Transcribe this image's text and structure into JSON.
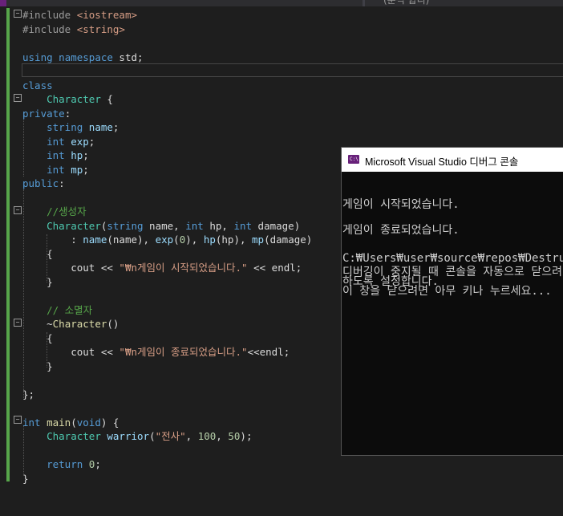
{
  "window": {
    "tab_text": "(분석 합니)"
  },
  "editor": {
    "lines": [
      {
        "parts": [
          {
            "t": "#include ",
            "c": "pp"
          },
          {
            "t": "<iostream>",
            "c": "inc"
          }
        ]
      },
      {
        "parts": [
          {
            "t": "#include ",
            "c": "pp"
          },
          {
            "t": "<string>",
            "c": "inc"
          }
        ]
      },
      {
        "parts": []
      },
      {
        "parts": [
          {
            "t": "using",
            "c": "kw"
          },
          {
            "t": " "
          },
          {
            "t": "namespace",
            "c": "kw"
          },
          {
            "t": " std;"
          }
        ]
      },
      {
        "parts": []
      },
      {
        "parts": [
          {
            "t": "class",
            "c": "kw"
          }
        ]
      },
      {
        "parts": [
          {
            "t": "    "
          },
          {
            "t": "Character",
            "c": "ty"
          },
          {
            "t": " {"
          }
        ]
      },
      {
        "parts": [
          {
            "t": "private",
            "c": "kw"
          },
          {
            "t": ":"
          }
        ]
      },
      {
        "parts": [
          {
            "t": "    "
          },
          {
            "t": "string",
            "c": "kw"
          },
          {
            "t": " "
          },
          {
            "t": "name",
            "c": "pr"
          },
          {
            "t": ";"
          }
        ]
      },
      {
        "parts": [
          {
            "t": "    "
          },
          {
            "t": "int",
            "c": "kw"
          },
          {
            "t": " "
          },
          {
            "t": "exp",
            "c": "pr"
          },
          {
            "t": ";"
          }
        ]
      },
      {
        "parts": [
          {
            "t": "    "
          },
          {
            "t": "int",
            "c": "kw"
          },
          {
            "t": " "
          },
          {
            "t": "hp",
            "c": "pr"
          },
          {
            "t": ";"
          }
        ]
      },
      {
        "parts": [
          {
            "t": "    "
          },
          {
            "t": "int",
            "c": "kw"
          },
          {
            "t": " "
          },
          {
            "t": "mp",
            "c": "pr"
          },
          {
            "t": ";"
          }
        ]
      },
      {
        "parts": [
          {
            "t": "public",
            "c": "kw"
          },
          {
            "t": ":"
          }
        ]
      },
      {
        "parts": []
      },
      {
        "parts": [
          {
            "t": "    "
          },
          {
            "t": "//생성자",
            "c": "cm"
          }
        ]
      },
      {
        "parts": [
          {
            "t": "    "
          },
          {
            "t": "Character",
            "c": "ty"
          },
          {
            "t": "("
          },
          {
            "t": "string",
            "c": "kw"
          },
          {
            "t": " name, "
          },
          {
            "t": "int",
            "c": "kw"
          },
          {
            "t": " hp, "
          },
          {
            "t": "int",
            "c": "kw"
          },
          {
            "t": " damage)"
          }
        ]
      },
      {
        "parts": [
          {
            "t": "        : "
          },
          {
            "t": "name",
            "c": "pr"
          },
          {
            "t": "(name), "
          },
          {
            "t": "exp",
            "c": "pr"
          },
          {
            "t": "("
          },
          {
            "t": "0",
            "c": "nm"
          },
          {
            "t": "), "
          },
          {
            "t": "hp",
            "c": "pr"
          },
          {
            "t": "(hp), "
          },
          {
            "t": "mp",
            "c": "pr"
          },
          {
            "t": "(damage)"
          }
        ]
      },
      {
        "parts": [
          {
            "t": "    {"
          }
        ]
      },
      {
        "parts": [
          {
            "t": "        cout << "
          },
          {
            "t": "\"₩n게임이 시작되었습니다.\"",
            "c": "st"
          },
          {
            "t": " << endl;"
          }
        ]
      },
      {
        "parts": [
          {
            "t": "    }"
          }
        ]
      },
      {
        "parts": []
      },
      {
        "parts": [
          {
            "t": "    "
          },
          {
            "t": "// 소멸자",
            "c": "cm"
          }
        ]
      },
      {
        "parts": [
          {
            "t": "    ~"
          },
          {
            "t": "Character",
            "c": "fn"
          },
          {
            "t": "()"
          }
        ]
      },
      {
        "parts": [
          {
            "t": "    {"
          }
        ]
      },
      {
        "parts": [
          {
            "t": "        cout << "
          },
          {
            "t": "\"₩n게임이 종료되었습니다.\"",
            "c": "st"
          },
          {
            "t": "<<endl;"
          }
        ]
      },
      {
        "parts": [
          {
            "t": "    }"
          }
        ]
      },
      {
        "parts": []
      },
      {
        "parts": [
          {
            "t": "};"
          }
        ]
      },
      {
        "parts": []
      },
      {
        "parts": [
          {
            "t": "int",
            "c": "kw"
          },
          {
            "t": " "
          },
          {
            "t": "main",
            "c": "fn"
          },
          {
            "t": "("
          },
          {
            "t": "void",
            "c": "kw"
          },
          {
            "t": ") {"
          }
        ]
      },
      {
        "parts": [
          {
            "t": "    "
          },
          {
            "t": "Character",
            "c": "ty"
          },
          {
            "t": " "
          },
          {
            "t": "warrior",
            "c": "pr"
          },
          {
            "t": "("
          },
          {
            "t": "\"전사\"",
            "c": "st"
          },
          {
            "t": ", "
          },
          {
            "t": "100",
            "c": "nm"
          },
          {
            "t": ", "
          },
          {
            "t": "50",
            "c": "nm"
          },
          {
            "t": ");"
          }
        ]
      },
      {
        "parts": []
      },
      {
        "parts": [
          {
            "t": "    "
          },
          {
            "t": "return",
            "c": "kw"
          },
          {
            "t": " "
          },
          {
            "t": "0",
            "c": "nm"
          },
          {
            "t": ";"
          }
        ]
      },
      {
        "parts": [
          {
            "t": "}"
          }
        ]
      }
    ],
    "fold_markers": [
      "⊟",
      "⊟",
      "⊟",
      "⊟",
      "⊟"
    ]
  },
  "console": {
    "title": "Microsoft Visual Studio 디버그 콘솔",
    "icon": "C:\\",
    "lines": [
      "",
      "게임이 시작되었습니다.",
      "",
      "게임이 종료되었습니다.",
      "",
      "C:₩Users₩user₩source₩repos₩Destructor",
      "디버깅이 중지될 때 콘솔을 자동으로 닫으려면",
      "하도록 설정합니다.",
      "이 창을 닫으려면 아무 키나 누르세요..."
    ]
  }
}
